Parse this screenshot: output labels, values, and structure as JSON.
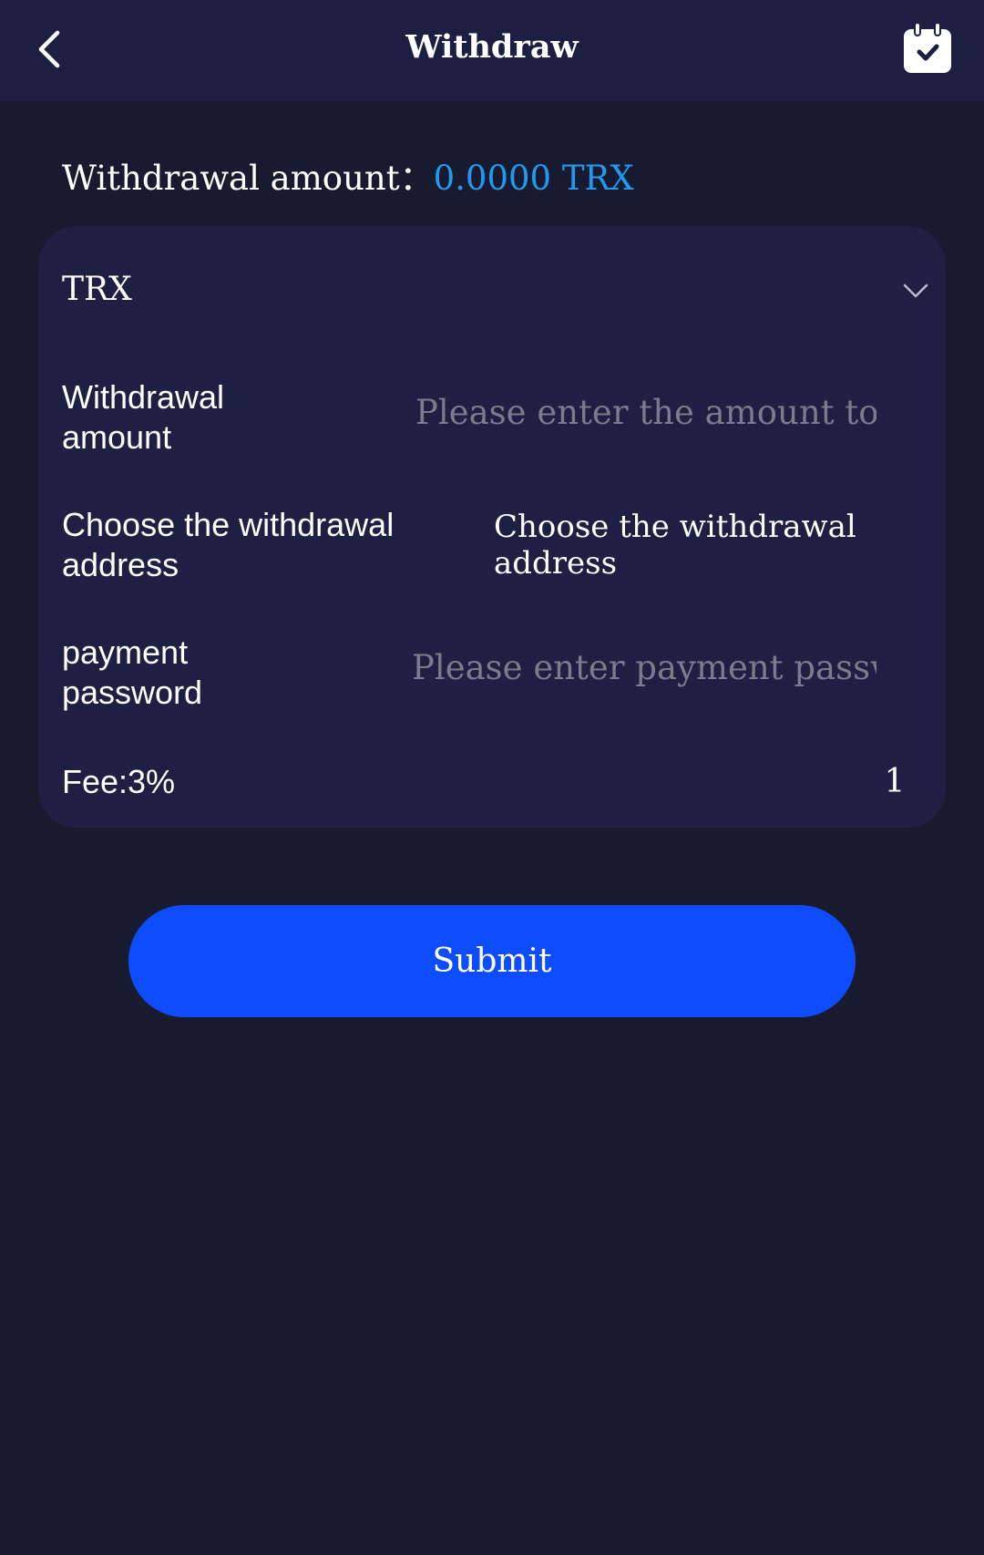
{
  "header": {
    "title": "Withdraw",
    "back_icon": "chevron-left-icon",
    "right_icon": "calendar-check-icon"
  },
  "balance": {
    "label": "Withdrawal amount：",
    "value": "0.0000 TRX",
    "value_color": "#1f9af0"
  },
  "form": {
    "currency": "TRX",
    "amount_label": "Withdrawal amount",
    "amount_placeholder": "Please enter the amount to withdraw",
    "address_label": "Choose the withdrawal address",
    "address_value": "Choose the withdrawal address",
    "password_label": "payment password",
    "password_placeholder": "Please enter payment password",
    "fee_label": "Fee:3%",
    "fee_value": "1"
  },
  "submit": {
    "label": "Submit",
    "color": "#0d4dfd"
  },
  "colors": {
    "background": "#181a30",
    "header": "#1c1f41",
    "card": "#1d1f43"
  }
}
